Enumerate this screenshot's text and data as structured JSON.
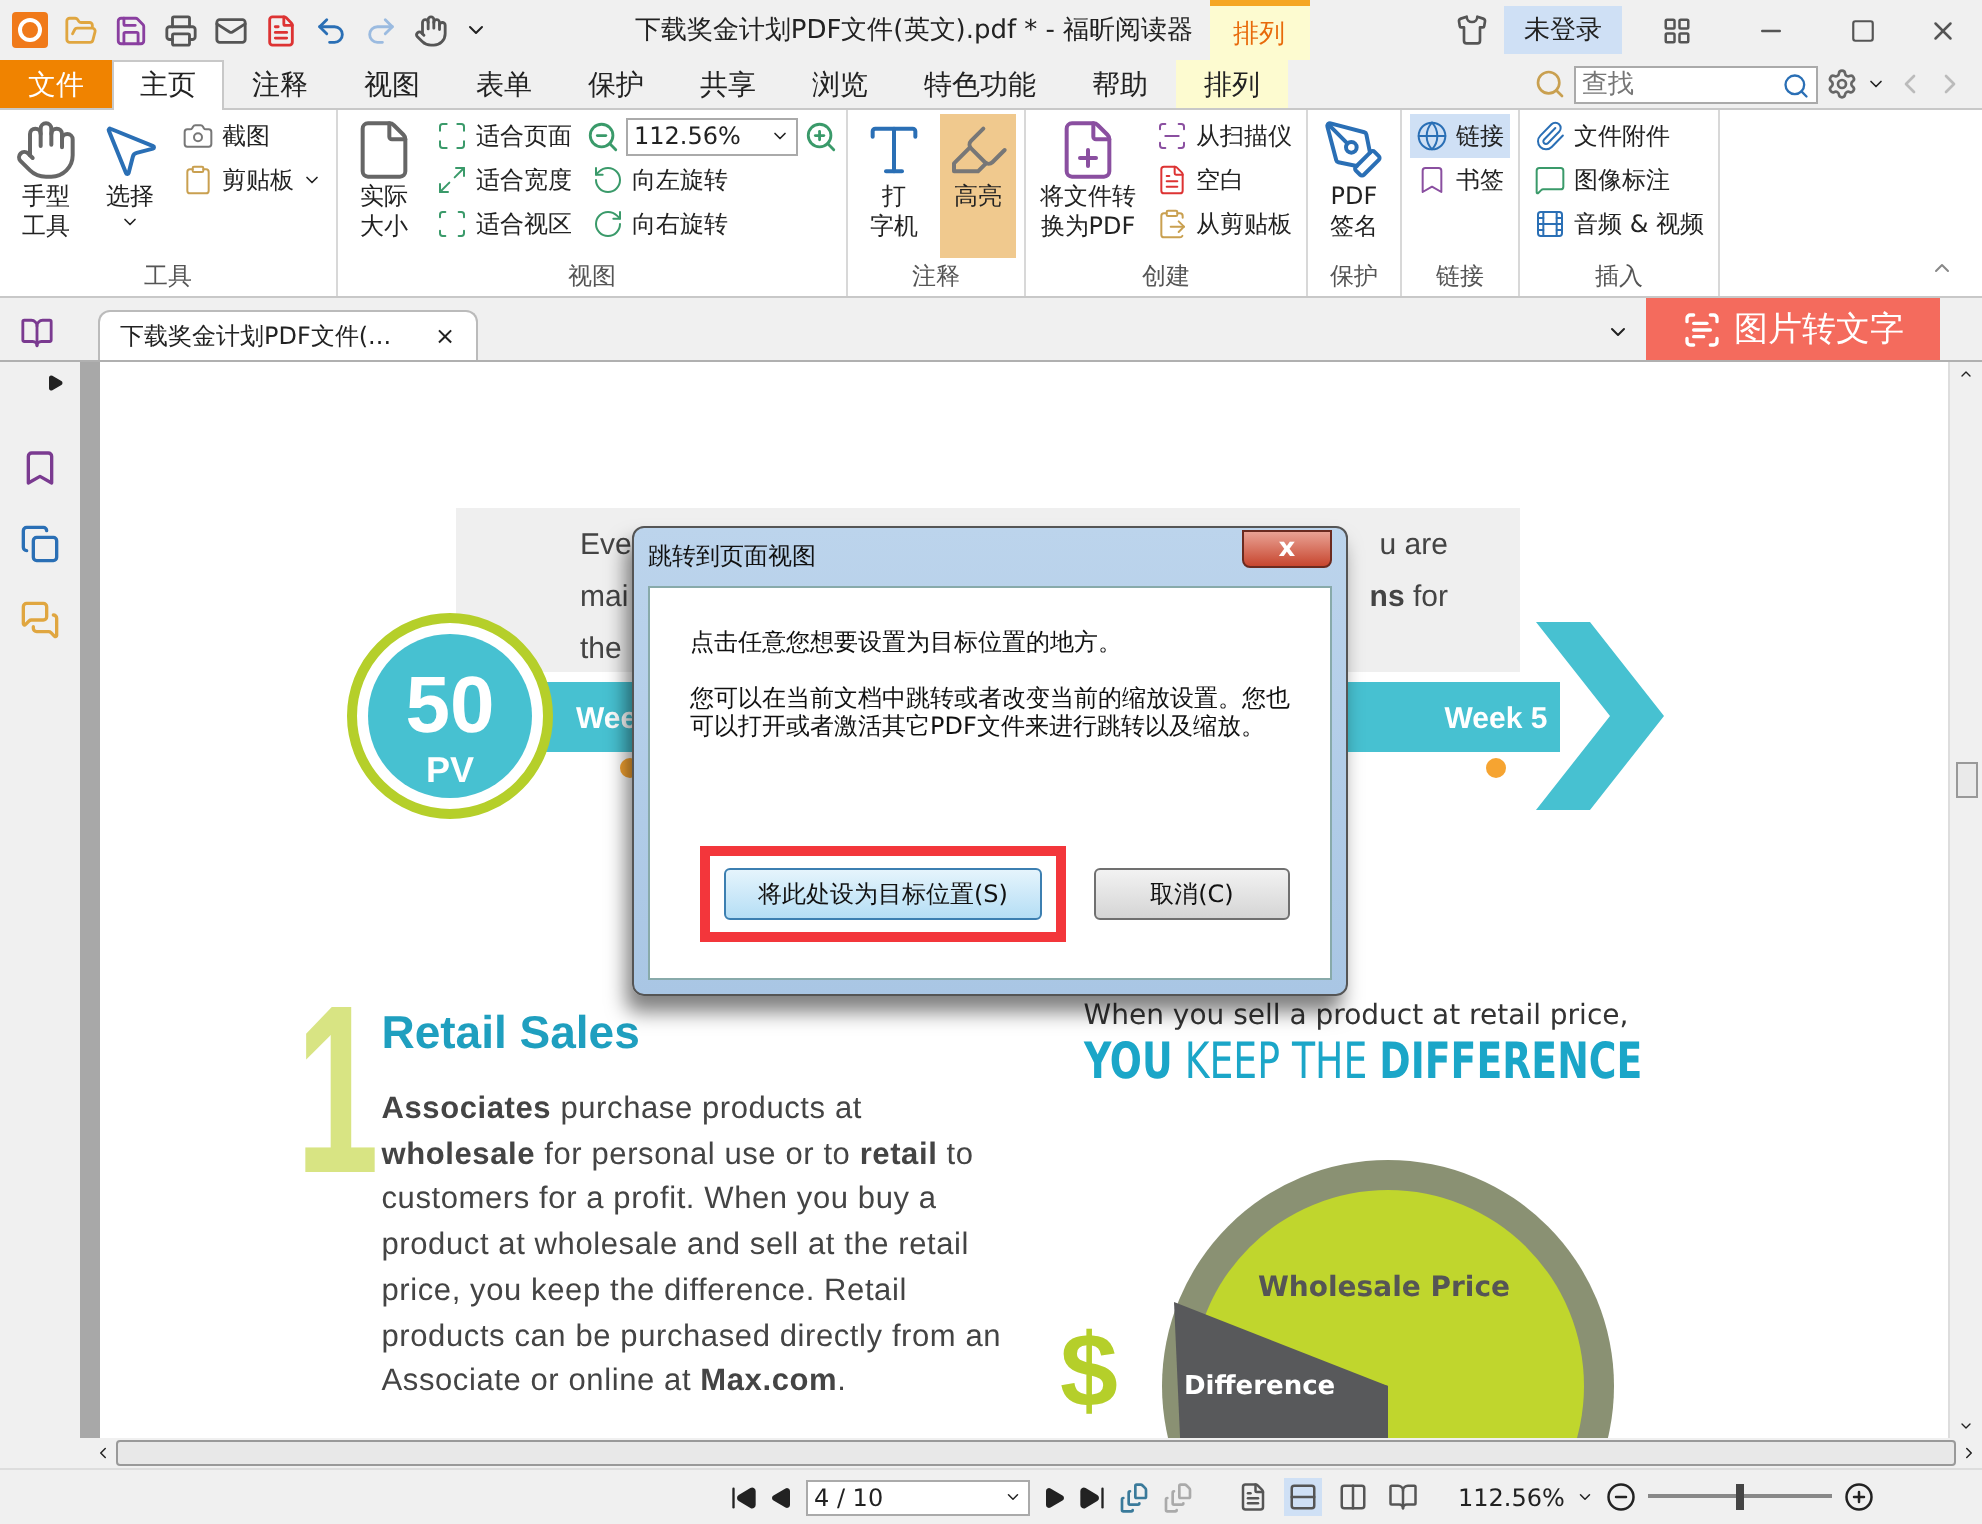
{
  "title_bar": {
    "title": "下载奖金计划PDF文件(英文).pdf * - 福昕阅读器",
    "context_label": "排列",
    "login": "未登录"
  },
  "menu_tabs": [
    {
      "label": "文件",
      "kind": "file",
      "selected": false
    },
    {
      "label": "主页",
      "kind": "tab",
      "selected": true
    },
    {
      "label": "注释",
      "kind": "tab",
      "selected": false
    },
    {
      "label": "视图",
      "kind": "tab",
      "selected": false
    },
    {
      "label": "表单",
      "kind": "tab",
      "selected": false
    },
    {
      "label": "保护",
      "kind": "tab",
      "selected": false
    },
    {
      "label": "共享",
      "kind": "tab",
      "selected": false
    },
    {
      "label": "浏览",
      "kind": "tab",
      "selected": false
    },
    {
      "label": "特色功能",
      "kind": "tab",
      "selected": false
    },
    {
      "label": "帮助",
      "kind": "tab",
      "selected": false
    },
    {
      "label": "排列",
      "kind": "context",
      "selected": false
    }
  ],
  "search": {
    "placeholder": "查找"
  },
  "ribbon_groups": [
    {
      "label": "工具",
      "columns": [
        [
          {
            "kind": "large",
            "lines": [
              "手型",
              "工具"
            ],
            "selected": false,
            "dropdown": false
          }
        ],
        [
          {
            "kind": "large",
            "lines": [
              "选择"
            ],
            "selected": false,
            "dropdown": true
          }
        ],
        [
          {
            "kind": "small",
            "label": "截图",
            "selected": false,
            "dropdown": false
          },
          {
            "kind": "small",
            "label": "剪贴板",
            "selected": false,
            "dropdown": true
          }
        ]
      ]
    },
    {
      "label": "视图",
      "columns": [
        [
          {
            "kind": "large",
            "lines": [
              "实际",
              "大小"
            ],
            "selected": false,
            "dropdown": false
          }
        ],
        [
          {
            "kind": "small",
            "label": "适合页面",
            "selected": false,
            "dropdown": false
          },
          {
            "kind": "small",
            "label": "适合宽度",
            "selected": false,
            "dropdown": false
          },
          {
            "kind": "small",
            "label": "适合视区",
            "selected": false,
            "dropdown": false
          }
        ],
        [
          {
            "kind": "zoom",
            "label": "112.56%",
            "selected": false,
            "dropdown": true
          },
          {
            "kind": "small",
            "label": "向左旋转",
            "selected": false,
            "dropdown": false
          },
          {
            "kind": "small",
            "label": "向右旋转",
            "selected": false,
            "dropdown": false
          }
        ]
      ]
    },
    {
      "label": "注释",
      "columns": [
        [
          {
            "kind": "large",
            "lines": [
              "打",
              "字机"
            ],
            "selected": false,
            "dropdown": false
          }
        ],
        [
          {
            "kind": "large",
            "lines": [
              "高亮"
            ],
            "selected": true,
            "dropdown": false
          }
        ]
      ]
    },
    {
      "label": "创建",
      "columns": [
        [
          {
            "kind": "large",
            "lines": [
              "将文件转",
              "换为PDF"
            ],
            "selected": false,
            "dropdown": false
          }
        ],
        [
          {
            "kind": "small",
            "label": "从扫描仪",
            "selected": false,
            "dropdown": false
          },
          {
            "kind": "small",
            "label": "空白",
            "selected": false,
            "dropdown": false
          },
          {
            "kind": "small",
            "label": "从剪贴板",
            "selected": false,
            "dropdown": false
          }
        ]
      ]
    },
    {
      "label": "保护",
      "columns": [
        [
          {
            "kind": "large",
            "lines": [
              "PDF",
              "签名"
            ],
            "selected": false,
            "dropdown": false
          }
        ]
      ]
    },
    {
      "label": "链接",
      "columns": [
        [
          {
            "kind": "small",
            "label": "链接",
            "selected": true,
            "dropdown": false
          },
          {
            "kind": "small",
            "label": "书签",
            "selected": false,
            "dropdown": false
          }
        ]
      ]
    },
    {
      "label": "插入",
      "columns": [
        [
          {
            "kind": "small",
            "label": "文件附件",
            "selected": false,
            "dropdown": false
          },
          {
            "kind": "small",
            "label": "图像标注",
            "selected": false,
            "dropdown": false
          },
          {
            "kind": "small",
            "label": "音频 & 视频",
            "selected": false,
            "dropdown": false
          }
        ]
      ]
    }
  ],
  "doc_tab": {
    "label": "下载奖金计划PDF文件(...",
    "close": "×"
  },
  "ocr_button": {
    "label": "图片转文字"
  },
  "page": {
    "intro_left": [
      "Eve",
      "mai",
      "the"
    ],
    "intro_right": [
      "u are",
      "**ns** for"
    ],
    "badge_number": "50",
    "badge_unit": "PV",
    "weeks": [
      "Wee",
      "Week 5"
    ],
    "section_number": "1",
    "heading": "Retail Sales",
    "paragraph": "**Associates** purchase products at **wholesale** for personal use or to **retail** to customers for a profit. When you buy a product at wholesale and sell at the retail price, you keep the difference. Retail products can be purchased directly from an Associate or online at **Max.com**.",
    "chart_subtitle": "When you sell a product at retail price,",
    "chart_title": "**YOU** KEEP THE **DIFFERENCE**",
    "currency": "$",
    "pie_labels": [
      "Wholesale Price",
      "Difference"
    ]
  },
  "dialog": {
    "title": "跳转到页面视图",
    "close": "x",
    "message": "点击任意您想要设置为目标位置的地方。",
    "detail": "您可以在当前文档中跳转或者改变当前的缩放设置。您也可以打开或者激活其它PDF文件来进行跳转以及缩放。",
    "buttons": [
      {
        "label": "将此处设为目标位置(S)",
        "default": true,
        "outlined": true
      },
      {
        "label": "取消(C)",
        "default": false,
        "outlined": false
      }
    ]
  },
  "status_bar": {
    "page": "4 / 10",
    "zoom": "112.56%",
    "view_modes": [
      {
        "selected": false
      },
      {
        "selected": true
      },
      {
        "selected": false
      },
      {
        "selected": false
      }
    ],
    "zoom_slider": {
      "level": 0.5
    }
  }
}
